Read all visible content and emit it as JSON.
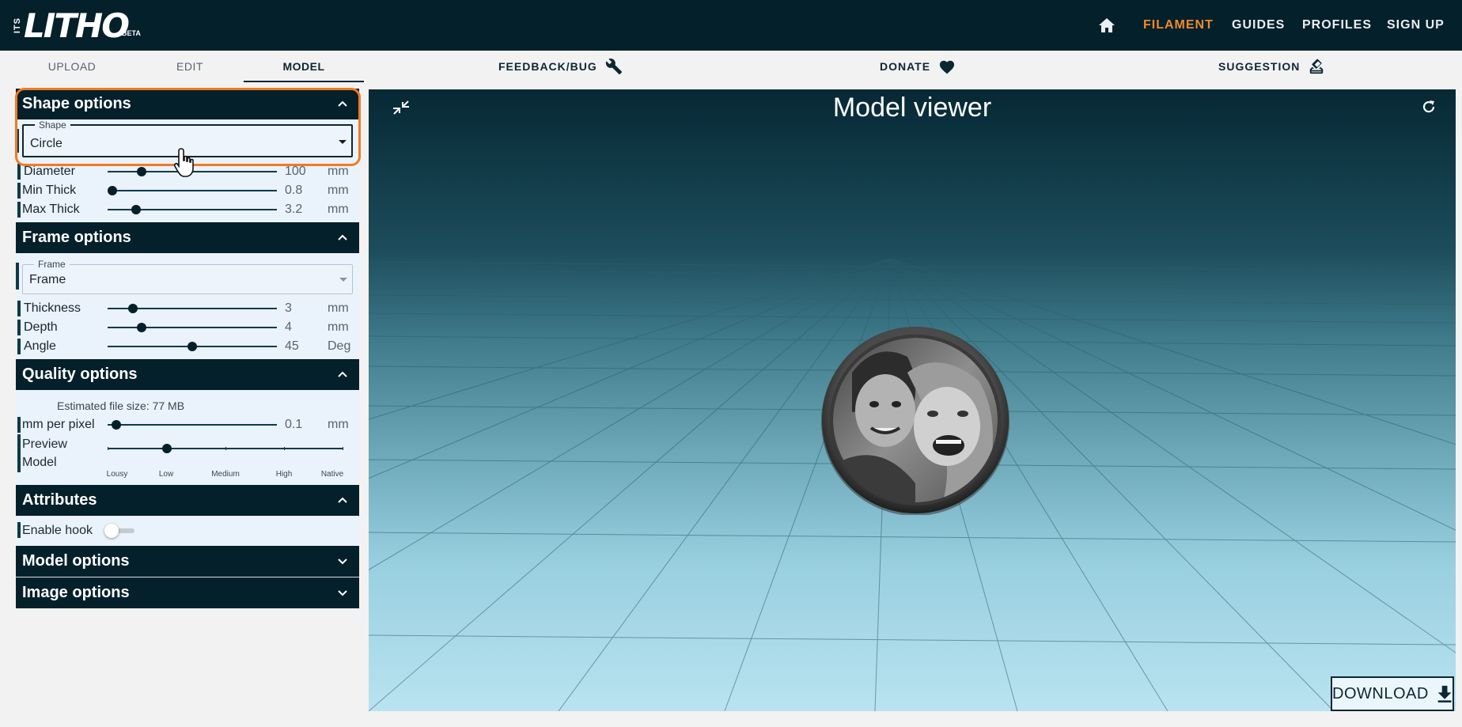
{
  "app": {
    "logo": {
      "prefix": "ITS",
      "word": "LITHO",
      "badge": "BETA"
    }
  },
  "nav": {
    "home_icon": "home-icon",
    "items": [
      {
        "label": "FILAMENT",
        "active": true,
        "color": "#ef8a2a"
      },
      {
        "label": "GUIDES"
      },
      {
        "label": "PROFILES"
      },
      {
        "label": "SIGN UP"
      }
    ]
  },
  "tabs": [
    {
      "label": "UPLOAD"
    },
    {
      "label": "EDIT"
    },
    {
      "label": "MODEL",
      "active": true
    }
  ],
  "actions": [
    {
      "label": "FEEDBACK/BUG",
      "icon": "wrench-icon"
    },
    {
      "label": "DONATE",
      "icon": "heart-icon"
    },
    {
      "label": "SUGGESTION",
      "icon": "ballot-box-icon"
    }
  ],
  "shape_options": {
    "title": "Shape options",
    "shape_select": {
      "legend": "Shape",
      "value": "Circle"
    },
    "sliders": [
      {
        "label": "Diameter",
        "value": "100",
        "unit": "mm",
        "fraction": 0.2
      },
      {
        "label": "Min Thick",
        "value": "0.8",
        "unit": "mm",
        "fraction": 0.03
      },
      {
        "label": "Max Thick",
        "value": "3.2",
        "unit": "mm",
        "fraction": 0.17
      }
    ]
  },
  "frame_options": {
    "title": "Frame options",
    "frame_select": {
      "legend": "Frame",
      "value": "Frame"
    },
    "sliders": [
      {
        "label": "Thickness",
        "value": "3",
        "unit": "mm",
        "fraction": 0.15
      },
      {
        "label": "Depth",
        "value": "4",
        "unit": "mm",
        "fraction": 0.2
      },
      {
        "label": "Angle",
        "value": "45",
        "unit": "Deg",
        "fraction": 0.5
      }
    ]
  },
  "quality_options": {
    "title": "Quality options",
    "estimate": "Estimated file size: 77 MB",
    "mm_per_pixel": {
      "label": "mm per pixel",
      "value": "0.1",
      "unit": "mm",
      "fraction": 0.05
    },
    "preview": {
      "label_line1": "Preview",
      "label_line2": "Model",
      "ticks": [
        "Lousy",
        "Low",
        "Medium",
        "High",
        "Native"
      ],
      "selected_index": 1
    }
  },
  "attributes": {
    "title": "Attributes",
    "hook": {
      "label": "Enable hook",
      "enabled": false
    }
  },
  "model_options": {
    "title": "Model options"
  },
  "image_options": {
    "title": "Image options"
  },
  "viewer": {
    "title": "Model viewer",
    "download_label": "DOWNLOAD"
  },
  "colors": {
    "header_bg": "#04202b",
    "accent": "#ef8a2a",
    "panel_bg": "#eaf2fc"
  }
}
